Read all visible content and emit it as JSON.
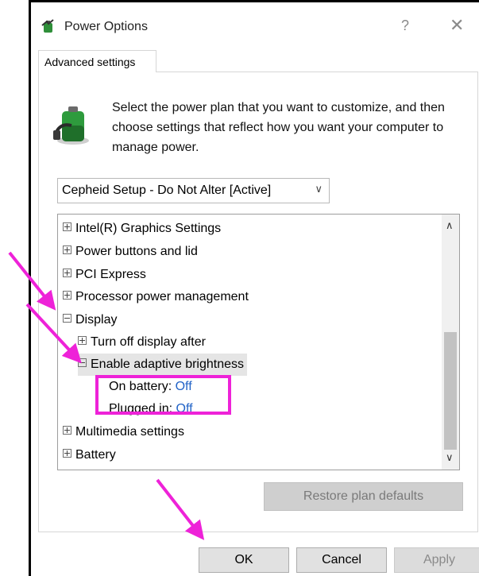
{
  "window": {
    "title": "Power Options",
    "help_label": "?",
    "close_label": "✕"
  },
  "tab": {
    "label": "Advanced settings"
  },
  "intro": {
    "text": "Select the power plan that you want to customize, and then choose settings that reflect how you want your computer to manage power."
  },
  "plan_select": {
    "value": "Cepheid Setup - Do Not Alter [Active]"
  },
  "tree": {
    "intel_graphics": "Intel(R) Graphics Settings",
    "power_buttons": "Power buttons and lid",
    "pci_express": "PCI Express",
    "processor": "Processor power management",
    "display": "Display",
    "turn_off_display": "Turn off display after",
    "adaptive_brightness": "Enable adaptive brightness",
    "on_battery_label": "On battery:",
    "on_battery_value": "Off",
    "plugged_in_label": "Plugged in:",
    "plugged_in_value": "Off",
    "multimedia": "Multimedia settings",
    "battery": "Battery"
  },
  "buttons": {
    "restore": "Restore plan defaults",
    "ok": "OK",
    "cancel": "Cancel",
    "apply": "Apply"
  },
  "colors": {
    "annotation": "#ee22d8",
    "link_value": "#2263c7"
  }
}
